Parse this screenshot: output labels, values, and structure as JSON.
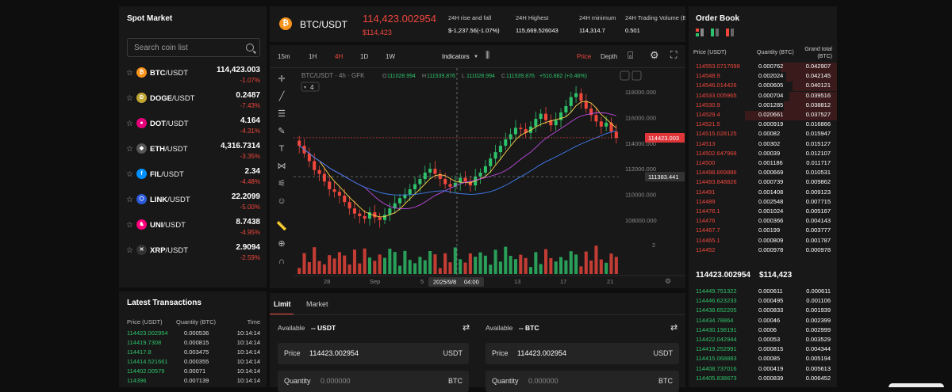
{
  "spot_market": {
    "title": "Spot Market",
    "search_placeholder": "Search coin list",
    "coins": [
      {
        "symbol": "BTC",
        "quote": "/USDT",
        "price": "114,423.003",
        "change": "-1.07%",
        "color": "#f7931a",
        "glyph": "₿"
      },
      {
        "symbol": "DOGE",
        "quote": "/USDT",
        "price": "0.2487",
        "change": "-7.43%",
        "color": "#c2a633",
        "glyph": "Ð"
      },
      {
        "symbol": "DOT",
        "quote": "/USDT",
        "price": "4.164",
        "change": "-4.31%",
        "color": "#e6007a",
        "glyph": "●"
      },
      {
        "symbol": "ETH",
        "quote": "/USDT",
        "price": "4,316.7314",
        "change": "-3.35%",
        "color": "#555",
        "glyph": "◆"
      },
      {
        "symbol": "FIL",
        "quote": "/USDT",
        "price": "2.34",
        "change": "-4.48%",
        "color": "#0090ff",
        "glyph": "f"
      },
      {
        "symbol": "LINK",
        "quote": "/USDT",
        "price": "22.2099",
        "change": "-5.00%",
        "color": "#2a5ada",
        "glyph": "⬡"
      },
      {
        "symbol": "UNI",
        "quote": "/USDT",
        "price": "8.7438",
        "change": "-4.95%",
        "color": "#ff007a",
        "glyph": "♞"
      },
      {
        "symbol": "XRP",
        "quote": "/USDT",
        "price": "2.9094",
        "change": "-2.59%",
        "color": "#333",
        "glyph": "✕"
      }
    ]
  },
  "latest_transactions": {
    "title": "Latest Transactions",
    "headers": [
      "Price (USDT)",
      "Quantity (BTC)",
      "Time"
    ],
    "rows": [
      [
        "114423.002954",
        "0.000536",
        "10:14:14"
      ],
      [
        "114419.7308",
        "0.000815",
        "10:14:14"
      ],
      [
        "114417.8",
        "0.003475",
        "10:14:14"
      ],
      [
        "114414.521661",
        "0.000355",
        "10:14:14"
      ],
      [
        "114402.00579",
        "0.00071",
        "10:14:14"
      ],
      [
        "114396",
        "0.007139",
        "10:14:14"
      ]
    ]
  },
  "header": {
    "pair": "BTC/USDT",
    "price": "114,423.002954",
    "price_usd": "$114,423",
    "stats": [
      {
        "label": "24H rise and fall",
        "value": "$-1,237.56(-1.07%)",
        "red": true
      },
      {
        "label": "24H Highest",
        "value": "115,669.526043",
        "red": false
      },
      {
        "label": "24H minimum",
        "value": "114,314.7",
        "red": false
      },
      {
        "label": "24H Trading Volume (B",
        "value": "0.501",
        "red": false
      }
    ]
  },
  "chart_toolbar": {
    "timeframes": [
      "15m",
      "1H",
      "4H",
      "1D",
      "1W"
    ],
    "active_timeframe": "4H",
    "indicators": "Indicators",
    "price_tab": "Price",
    "depth_tab": "Depth"
  },
  "chart_data": {
    "type": "candlestick",
    "title": "BTC/USDT · 4h · GFK",
    "ohlc_label": {
      "o": "111028.994",
      "h": "111539.876",
      "l": "111028.994",
      "c": "111539.876",
      "chg": "+510.882 (+0.46%)"
    },
    "indicator_count": "4",
    "y_ticks": [
      "118000.000",
      "116000.000",
      "114000.000",
      "112000.000",
      "110000.000",
      "108000.000"
    ],
    "ylim": [
      106500,
      119000
    ],
    "x_ticks": [
      "28",
      "Sep",
      "5",
      "13",
      "17",
      "21"
    ],
    "crosshair_date": "2025/9/8",
    "crosshair_time": "04:00",
    "last_price_label": "114423.003",
    "crosshair_price_label": "111383.441",
    "volume_label": "2",
    "closes": [
      113800,
      113200,
      112600,
      111900,
      111600,
      111000,
      110400,
      110200,
      109900,
      109400,
      108900,
      108500,
      108300,
      108100,
      108600,
      108200,
      108000,
      108400,
      108900,
      109300,
      109700,
      110000,
      110400,
      110800,
      111200,
      111700,
      112000,
      111600,
      111200,
      110800,
      110600,
      110900,
      111300,
      111000,
      110700,
      111400,
      111700,
      112200,
      112800,
      113300,
      113800,
      114300,
      114700,
      115200,
      115100,
      114800,
      115300,
      115900,
      116300,
      115800,
      115400,
      115800,
      116400,
      116900,
      117600,
      117900,
      117300,
      116700,
      116200,
      115700,
      115300,
      115600,
      114900,
      114423
    ]
  },
  "order_book": {
    "title": "Order Book",
    "headers": [
      "Price (USDT)",
      "Quantity (BTC)",
      "Grand total (BTC)"
    ],
    "asks": [
      [
        "114553.0717098",
        "0.000762",
        "0.042907"
      ],
      [
        "114548.9",
        "0.002024",
        "0.042145"
      ],
      [
        "114546.014426",
        "0.000605",
        "0.040121"
      ],
      [
        "114533.005965",
        "0.000704",
        "0.039516"
      ],
      [
        "114530.9",
        "0.001285",
        "0.038812"
      ],
      [
        "114529.4",
        "0.020661",
        "0.037527"
      ],
      [
        "114521.5",
        "0.000919",
        "0.016866"
      ],
      [
        "114515.028125",
        "0.00082",
        "0.015947"
      ],
      [
        "114513",
        "0.00302",
        "0.015127"
      ],
      [
        "114502.647968",
        "0.00039",
        "0.012107"
      ],
      [
        "114500",
        "0.001186",
        "0.011717"
      ],
      [
        "114498.669886",
        "0.000669",
        "0.010531"
      ],
      [
        "114493.848826",
        "0.000739",
        "0.009862"
      ],
      [
        "114491",
        "0.001408",
        "0.009123"
      ],
      [
        "114489",
        "0.002548",
        "0.007715"
      ],
      [
        "114476.1",
        "0.001024",
        "0.005167"
      ],
      [
        "114476",
        "0.000366",
        "0.004143"
      ],
      [
        "114467.7",
        "0.00199",
        "0.003777"
      ],
      [
        "114465.1",
        "0.000809",
        "0.001787"
      ],
      [
        "114452",
        "0.000978",
        "0.000978"
      ]
    ],
    "ask_depth": [
      0.38,
      0.34,
      0.3,
      0.32,
      0.36,
      0.62,
      0,
      0,
      0,
      0,
      0,
      0,
      0,
      0,
      0,
      0,
      0,
      0,
      0,
      0
    ],
    "mid_price": "114423.002954",
    "mid_usd": "$114,423",
    "bids": [
      [
        "114449.751322",
        "0.000611",
        "0.000611"
      ],
      [
        "114446.623233",
        "0.000495",
        "0.001106"
      ],
      [
        "114438.652205",
        "0.000833",
        "0.001939"
      ],
      [
        "114434.78864",
        "0.00046",
        "0.002399"
      ],
      [
        "114430.198191",
        "0.0006",
        "0.002999"
      ],
      [
        "114422.042944",
        "0.00053",
        "0.003529"
      ],
      [
        "114419.252991",
        "0.000815",
        "0.004344"
      ],
      [
        "114415.068883",
        "0.00085",
        "0.005194"
      ],
      [
        "114408.737016",
        "0.000419",
        "0.005613"
      ],
      [
        "114405.838673",
        "0.000839",
        "0.006452"
      ]
    ]
  },
  "trade": {
    "tab_limit": "Limit",
    "tab_market": "Market",
    "left": {
      "available": "Available",
      "amount": "-- USDT",
      "price_label": "Price",
      "price_value": "114423.002954",
      "price_unit": "USDT",
      "qty_label": "Quantity",
      "qty_placeholder": "0.000000",
      "qty_unit": "BTC"
    },
    "right": {
      "available": "Available",
      "amount": "-- BTC",
      "price_label": "Price",
      "price_value": "114423.002954",
      "price_unit": "USDT",
      "qty_label": "Quantity",
      "qty_placeholder": "0.000000",
      "qty_unit": "BTC"
    }
  },
  "colors": {
    "up": "#2ec26a",
    "down": "#f0473d",
    "panel": "#181818",
    "background": "#0e0e0e"
  }
}
